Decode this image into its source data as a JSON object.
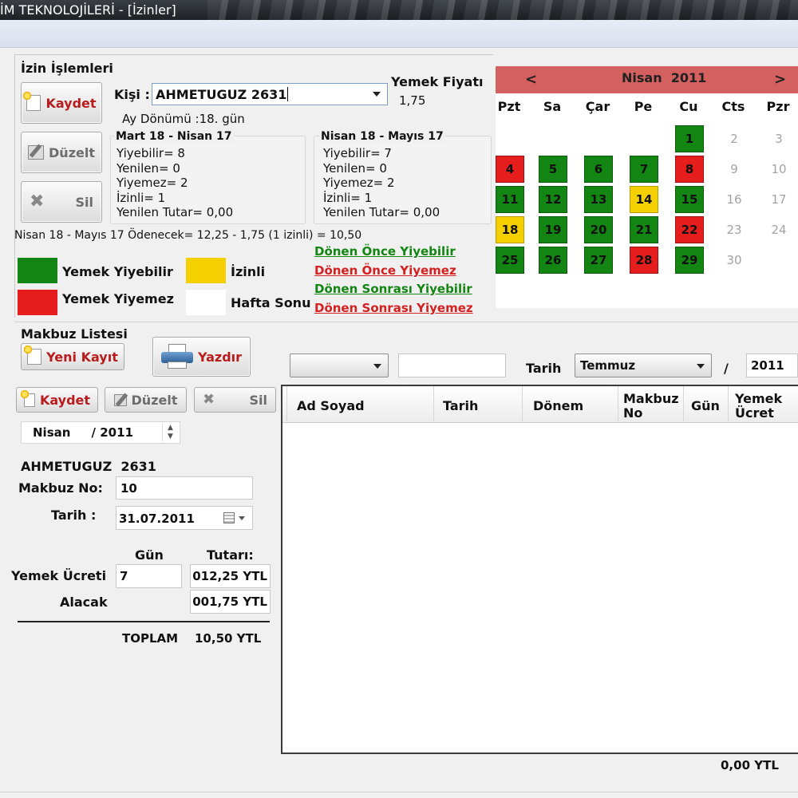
{
  "window": {
    "title": "İM TEKNOLOJİLERİ - [İzinler]"
  },
  "izin": {
    "section_title": "İzin İşlemleri",
    "buttons": {
      "kaydet": "Kaydet",
      "duzelt": "Düzelt",
      "sil": "Sil"
    },
    "kisi_label": "Kişi :",
    "kisi_value": "AHMETUGUZ  2631",
    "ay_donumu": "Ay Dönümü :18. gün",
    "yemek_fiyati_label": "Yemek Fiyatı",
    "yemek_fiyati_value": "1,75",
    "periods": [
      {
        "title": "Mart 18 - Nisan 17",
        "lines": [
          "Yiyebilir= 8",
          "Yenilen= 0",
          "Yiyemez= 2",
          "İzinli= 1",
          "Yenilen Tutar= 0,00"
        ]
      },
      {
        "title": "Nisan 18 - Mayıs 17",
        "lines": [
          "Yiyebilir= 7",
          "Yenilen= 0",
          "Yiyemez= 2",
          "İzinli= 1",
          "Yenilen Tutar= 0,00"
        ]
      }
    ],
    "summary": "Nisan 18 - Mayıs 17 Ödenecek= 12,25 - 1,75 (1 izinli) = 10,50",
    "legend": [
      {
        "label": "Yemek Yiyebilir",
        "color": "#128512"
      },
      {
        "label": "İzinli",
        "color": "#f5d000"
      },
      {
        "label": "Yemek Yiyemez",
        "color": "#e51d1d"
      },
      {
        "label": "Hafta Sonu",
        "color": "#ffffff"
      }
    ],
    "links": [
      {
        "label": "Dönen Önce Yiyebilir",
        "color": "#128512"
      },
      {
        "label": "Dönen Önce Yiyemez",
        "color": "#d42020"
      },
      {
        "label": "Dönen Sonrası Yiyebilir",
        "color": "#128512"
      },
      {
        "label": "Dönen Sonrası Yiyemez",
        "color": "#d42020"
      }
    ]
  },
  "calendar": {
    "prev": "<",
    "next": ">",
    "month_year": "Nisan  2011",
    "weekdays": [
      "Pzt",
      "Sa",
      "Çar",
      "Pe",
      "Cu",
      "Cts",
      "Pzr"
    ],
    "weeks": [
      [
        null,
        null,
        null,
        null,
        {
          "d": "1",
          "s": "g"
        },
        {
          "d": "2",
          "s": "w"
        },
        {
          "d": "3",
          "s": "w"
        }
      ],
      [
        {
          "d": "4",
          "s": "r"
        },
        {
          "d": "5",
          "s": "g"
        },
        {
          "d": "6",
          "s": "g"
        },
        {
          "d": "7",
          "s": "g"
        },
        {
          "d": "8",
          "s": "r"
        },
        {
          "d": "9",
          "s": "w"
        },
        {
          "d": "10",
          "s": "w"
        }
      ],
      [
        {
          "d": "11",
          "s": "g"
        },
        {
          "d": "12",
          "s": "g"
        },
        {
          "d": "13",
          "s": "g"
        },
        {
          "d": "14",
          "s": "y"
        },
        {
          "d": "15",
          "s": "g"
        },
        {
          "d": "16",
          "s": "w"
        },
        {
          "d": "17",
          "s": "w"
        }
      ],
      [
        {
          "d": "18",
          "s": "y"
        },
        {
          "d": "19",
          "s": "g"
        },
        {
          "d": "20",
          "s": "g"
        },
        {
          "d": "21",
          "s": "g"
        },
        {
          "d": "22",
          "s": "r"
        },
        {
          "d": "23",
          "s": "w"
        },
        {
          "d": "24",
          "s": "w"
        }
      ],
      [
        {
          "d": "25",
          "s": "g"
        },
        {
          "d": "26",
          "s": "g"
        },
        {
          "d": "27",
          "s": "g"
        },
        {
          "d": "28",
          "s": "r"
        },
        {
          "d": "29",
          "s": "g"
        },
        {
          "d": "30",
          "s": "w"
        },
        null
      ]
    ]
  },
  "makbuz": {
    "section_title": "Makbuz Listesi",
    "yeni_kayit": "Yeni Kayıt",
    "yazdir": "Yazdır",
    "buttons": {
      "kaydet": "Kaydet",
      "duzelt": "Düzelt",
      "sil": "Sil"
    },
    "month_spin": "Nisan     / 2011",
    "person": "AHMETUGUZ  2631",
    "makbuz_no_label": "Makbuz No:",
    "makbuz_no_value": "10",
    "tarih_label": "Tarih :",
    "tarih_value": "31.07.2011",
    "gun_header": "Gün",
    "tutar_header": "Tutarı:",
    "yemek_ucreti_label": "Yemek Ücreti",
    "yemek_gun": "7",
    "yemek_tutar": "012,25 YTL",
    "alacak_label": "Alacak",
    "alacak_tutar": "001,75 YTL",
    "toplam_label": "TOPLAM",
    "toplam_value": "10,50 YTL"
  },
  "filter": {
    "combo1": "",
    "text1": "",
    "tarih_label": "Tarih",
    "month": "Temmuz",
    "slash": "/",
    "year": "2011"
  },
  "table": {
    "columns": [
      "Ad Soyad",
      "Tarih",
      "Dönem",
      "Makbuz No",
      "Gün",
      "Yemek Ücret"
    ],
    "rows": [],
    "footer_total": "0,00 YTL"
  }
}
